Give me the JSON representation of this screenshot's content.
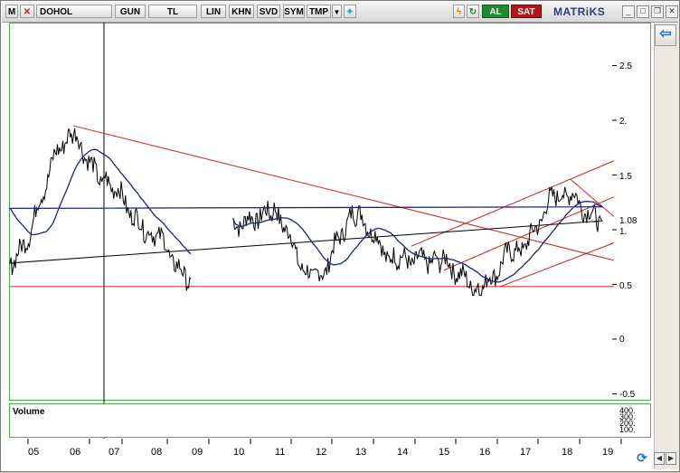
{
  "toolbar": {
    "m_label": "M",
    "symbol": "DOHOL",
    "buttons": [
      "GUN",
      "TL",
      "LIN",
      "KHN",
      "SVD",
      "SYM",
      "TMP"
    ],
    "buy_label": "AL",
    "sell_label": "SAT",
    "brand": "MATRiKS"
  },
  "chart": {
    "y_labels": [
      "2.5",
      "2.",
      "1.5",
      "1.08",
      "1.",
      "0.5",
      "0",
      "-0.5"
    ],
    "volume_label": "Volume",
    "volume_scale": [
      "400.",
      "300.",
      "200.",
      "100."
    ],
    "x_labels": [
      "05",
      "06",
      "07",
      "08",
      "09",
      "10",
      "11",
      "12",
      "13",
      "14",
      "15",
      "16",
      "17",
      "18",
      "19"
    ]
  },
  "colors": {
    "price": "#000000",
    "moving_average": "#1a237e",
    "trendline": "#cc2222",
    "volume": "#0a3d7a",
    "frame": "#4cae4c"
  },
  "chart_data": {
    "type": "line",
    "ylim": [
      -0.55,
      2.85
    ],
    "grid": false,
    "series": [
      {
        "values_by_year": {
          "05": 0.72,
          "06": 1.85,
          "07": 1.45,
          "08": 1.0,
          "09": 0.55,
          "10": 1.05,
          "11": 1.15,
          "12": 0.55,
          "13": 1.12,
          "14": 0.72,
          "15": 0.72,
          "16": 0.48,
          "17": 0.85,
          "18": 1.35,
          "19": 1.08
        }
      }
    ]
  }
}
